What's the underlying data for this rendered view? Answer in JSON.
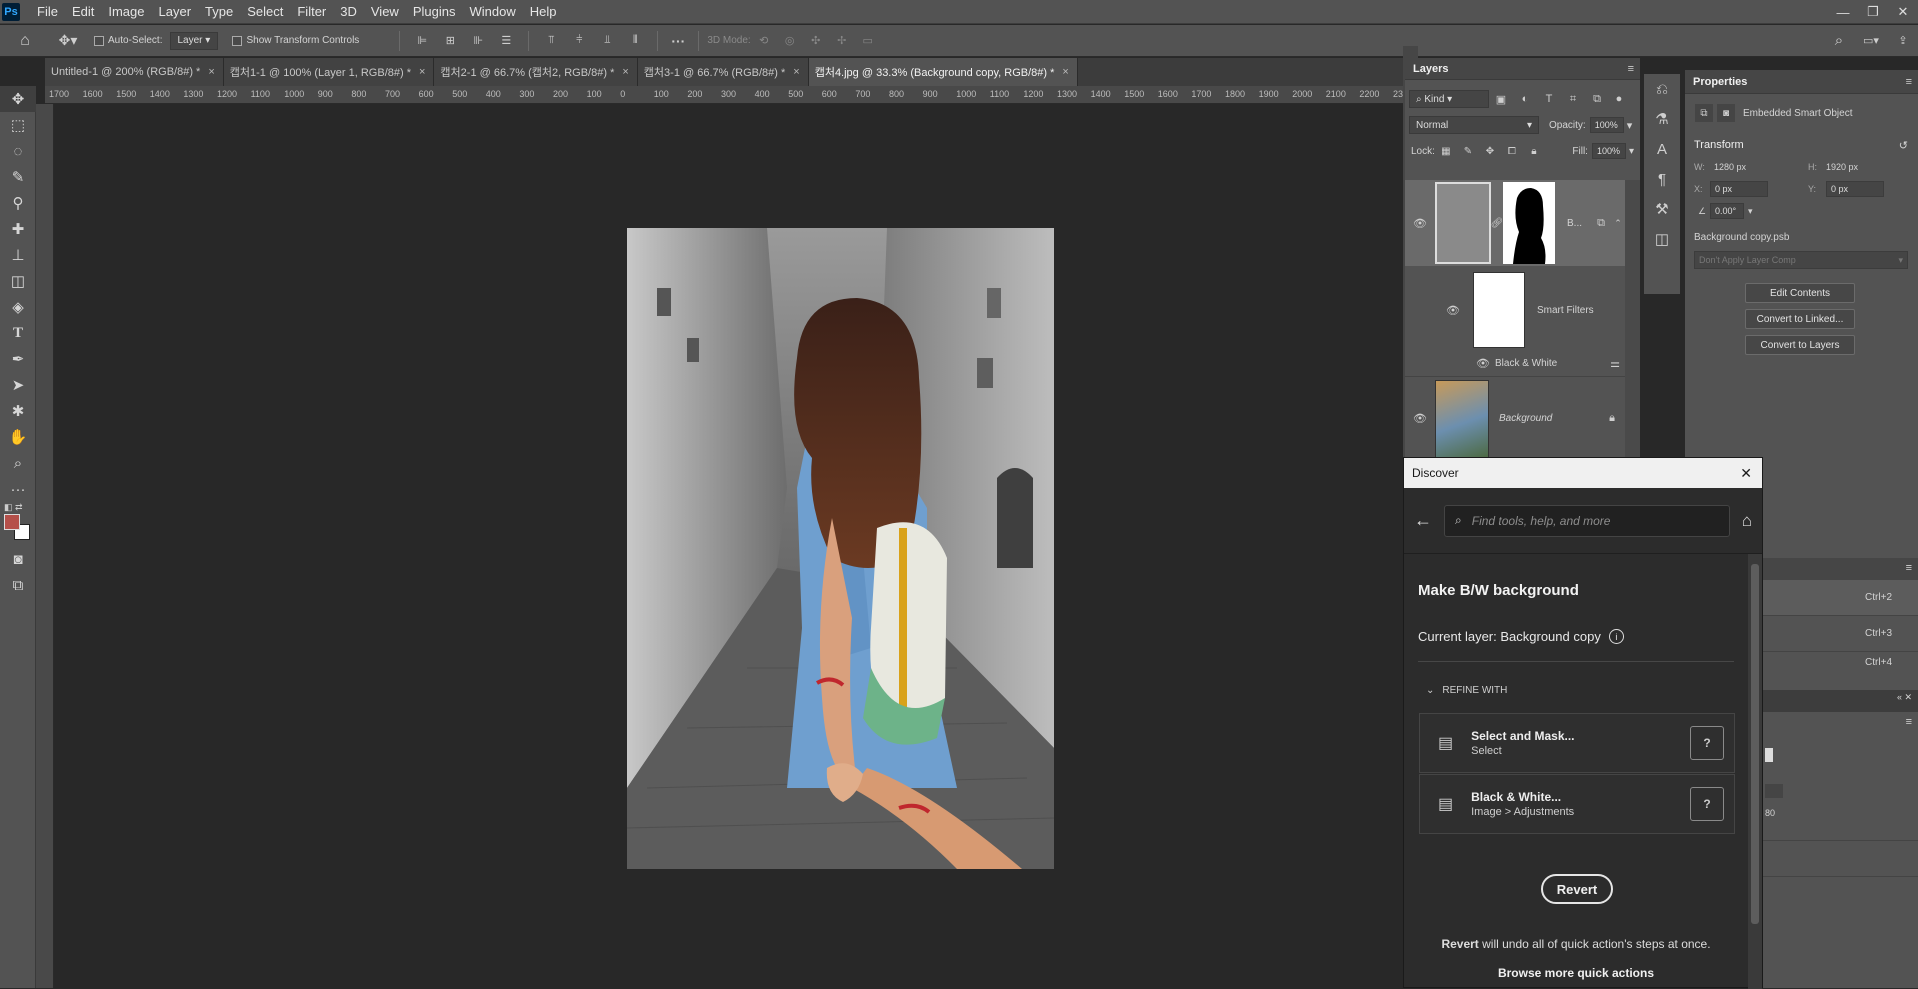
{
  "menubar": {
    "logo": "Ps",
    "items": [
      "File",
      "Edit",
      "Image",
      "Layer",
      "Type",
      "Select",
      "Filter",
      "3D",
      "View",
      "Plugins",
      "Window",
      "Help"
    ]
  },
  "options": {
    "auto_select_label": "Auto-Select:",
    "auto_select_value": "Layer",
    "show_transform_label": "Show Transform Controls",
    "mode_3d_label": "3D Mode:"
  },
  "tabs": [
    {
      "label": "Untitled-1 @ 200% (RGB/8#) *",
      "active": false
    },
    {
      "label": "캡처1-1 @ 100% (Layer 1, RGB/8#) *",
      "active": false
    },
    {
      "label": "캡처2-1 @ 66.7% (캡처2, RGB/8#) *",
      "active": false
    },
    {
      "label": "캡처3-1 @ 66.7% (RGB/8#) *",
      "active": false
    },
    {
      "label": "캡처4.jpg @ 33.3% (Background copy, RGB/8#) *",
      "active": true
    }
  ],
  "ruler": {
    "h_ticks": [
      "1700",
      "1600",
      "1500",
      "1400",
      "1300",
      "1200",
      "1100",
      "1000",
      "900",
      "800",
      "700",
      "600",
      "500",
      "400",
      "300",
      "200",
      "100",
      "0",
      "100",
      "200",
      "300",
      "400",
      "500",
      "600",
      "700",
      "800",
      "900",
      "1000",
      "1100",
      "1200",
      "1300",
      "1400",
      "1500",
      "1600",
      "1700",
      "1800",
      "1900",
      "2000",
      "2100",
      "2200",
      "23"
    ]
  },
  "layers_panel": {
    "title": "Layers",
    "filter_kind": "Kind",
    "blend_mode": "Normal",
    "opacity_label": "Opacity:",
    "opacity_value": "100%",
    "lock_label": "Lock:",
    "fill_label": "Fill:",
    "fill_value": "100%",
    "layers": [
      {
        "name": "B...",
        "type": "smart object with mask"
      },
      {
        "name": "Smart Filters",
        "type": "smart filters"
      },
      {
        "name": "Black & White",
        "type": "filter"
      },
      {
        "name": "Background",
        "type": "locked"
      }
    ]
  },
  "properties_panel": {
    "title": "Properties",
    "object_type": "Embedded Smart Object",
    "section": "Transform",
    "w_label": "W:",
    "w_value": "1280 px",
    "h_label": "H:",
    "h_value": "1920 px",
    "x_label": "X:",
    "x_value": "0 px",
    "y_label": "Y:",
    "y_value": "0 px",
    "angle_value": "0.00°",
    "file_name": "Background copy.psb",
    "layer_comp": "Don't Apply Layer Comp",
    "buttons": [
      "Edit Contents",
      "Convert to Linked...",
      "Convert to Layers"
    ]
  },
  "shortcuts": [
    "Ctrl+2",
    "Ctrl+3",
    "Ctrl+4"
  ],
  "lower_fragment_value": "80",
  "discover": {
    "title": "Discover",
    "search_placeholder": "Find tools, help, and more",
    "heading": "Make B/W background",
    "current_layer": "Current layer: Background copy",
    "refine_label": "REFINE WITH",
    "cards": [
      {
        "title": "Select and Mask...",
        "subtitle": "Select"
      },
      {
        "title": "Black & White...",
        "subtitle": "Image > Adjustments"
      }
    ],
    "revert_label": "Revert",
    "revert_note_bold": "Revert",
    "revert_note_rest": " will undo all of quick action's steps at once.",
    "browse_more": "Browse more quick actions"
  },
  "colors": {
    "foreground_swatch": "#b5504a",
    "background_swatch": "#ffffff",
    "panel_bg": "#535353",
    "canvas_bg": "#282828"
  }
}
